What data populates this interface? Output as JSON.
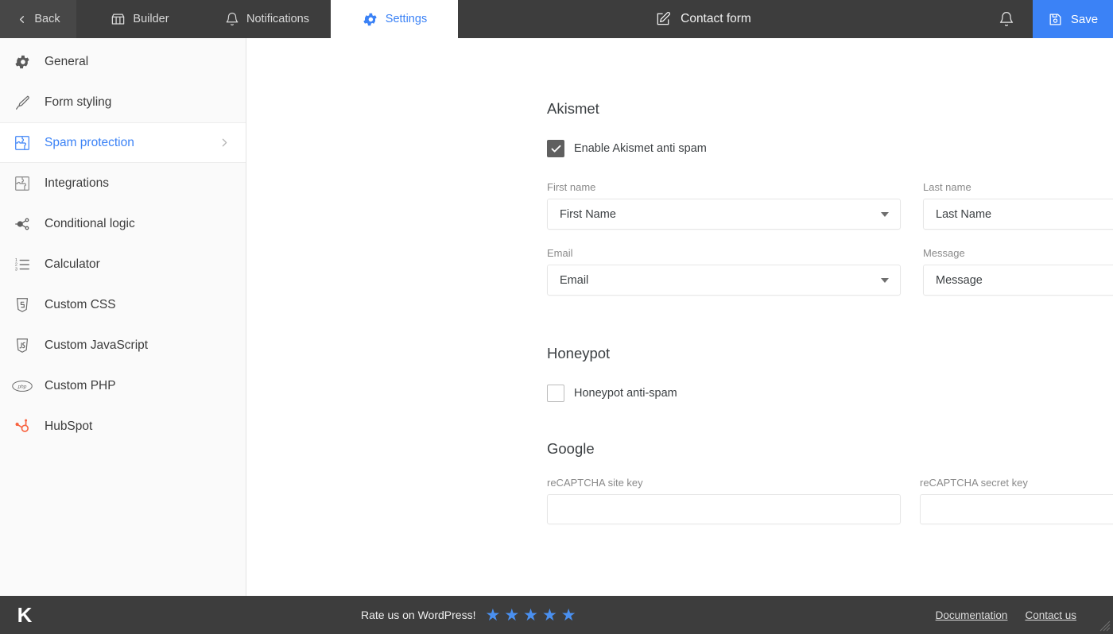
{
  "topbar": {
    "back_label": "Back",
    "back_icon": "chevron-left-icon",
    "tabs": [
      {
        "label": "Builder",
        "icon": "builder-icon",
        "active": false
      },
      {
        "label": "Notifications",
        "icon": "bell-icon",
        "active": false
      },
      {
        "label": "Settings",
        "icon": "gear-icon",
        "active": true
      }
    ],
    "form_title": "Contact form",
    "form_title_icon": "edit-pencil-icon",
    "notification_icon": "bell-icon",
    "save_label": "Save",
    "save_icon": "floppy-disk-icon",
    "accent_color": "#3b82f6",
    "bar_color": "#3d3d3d"
  },
  "sidebar": {
    "items": [
      {
        "label": "General",
        "icon": "gear-icon",
        "active": false,
        "chevron": false
      },
      {
        "label": "Form styling",
        "icon": "brush-icon",
        "active": false,
        "chevron": false
      },
      {
        "label": "Spam protection",
        "icon": "puzzle-icon",
        "active": true,
        "chevron": true
      },
      {
        "label": "Integrations",
        "icon": "puzzle-icon",
        "active": false,
        "chevron": false
      },
      {
        "label": "Conditional logic",
        "icon": "node-share-icon",
        "active": false,
        "chevron": false
      },
      {
        "label": "Calculator",
        "icon": "numbered-list-icon",
        "active": false,
        "chevron": false
      },
      {
        "label": "Custom CSS",
        "icon": "css-shield-icon",
        "active": false,
        "chevron": false
      },
      {
        "label": "Custom JavaScript",
        "icon": "js-shield-icon",
        "active": false,
        "chevron": false
      },
      {
        "label": "Custom PHP",
        "icon": "php-icon",
        "active": false,
        "chevron": false
      },
      {
        "label": "HubSpot",
        "icon": "hubspot-icon",
        "active": false,
        "chevron": false
      }
    ]
  },
  "content": {
    "akismet": {
      "title": "Akismet",
      "enable_label": "Enable Akismet anti spam",
      "enable_checked": true,
      "fields": [
        {
          "label": "First name",
          "value": "First Name"
        },
        {
          "label": "Last name",
          "value": "Last Name"
        },
        {
          "label": "Email",
          "value": "Email"
        },
        {
          "label": "Message",
          "value": "Message"
        }
      ]
    },
    "honeypot": {
      "title": "Honeypot",
      "enable_label": "Honeypot anti-spam",
      "enable_checked": false
    },
    "google": {
      "title": "Google",
      "fields": [
        {
          "label": "reCAPTCHA site key",
          "value": "",
          "placeholder": ""
        },
        {
          "label": "reCAPTCHA secret key",
          "value": "",
          "placeholder": ""
        }
      ]
    }
  },
  "footer": {
    "logo": "K",
    "rate_text": "Rate us on WordPress!",
    "stars": 5,
    "star_glyph": "★",
    "star_color": "#4a90f0",
    "links": [
      {
        "label": "Documentation"
      },
      {
        "label": "Contact us"
      }
    ]
  }
}
